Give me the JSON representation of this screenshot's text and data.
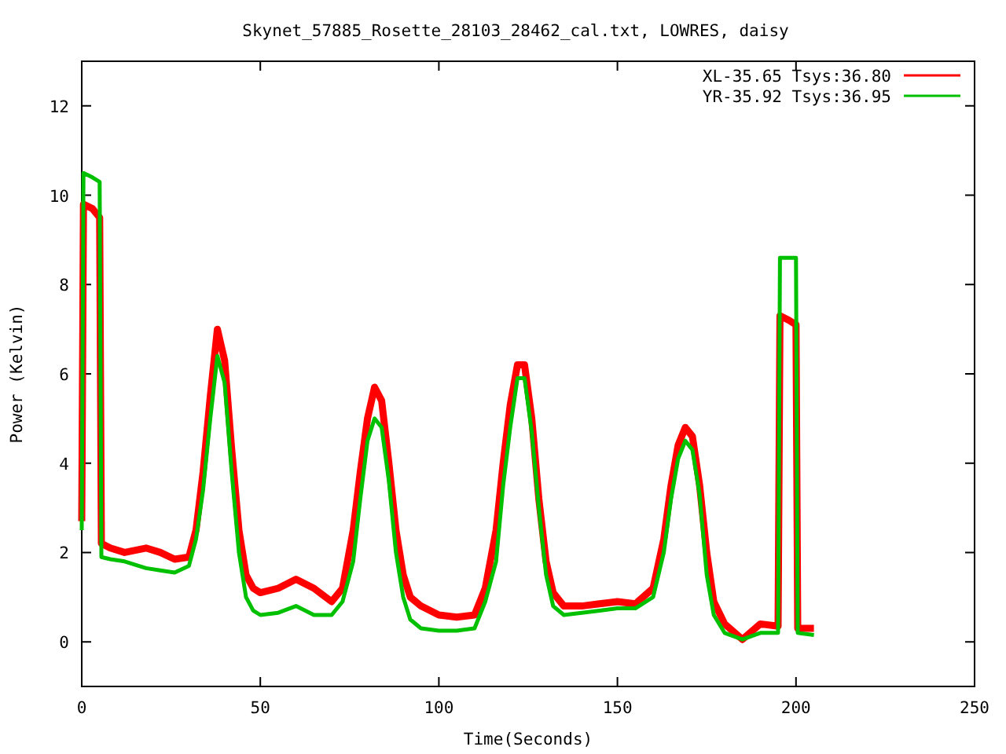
{
  "plot": {
    "chart_data": {
      "type": "line",
      "title": "Skynet_57885_Rosette_28103_28462_cal.txt, LOWRES, daisy",
      "xlabel": "Time(Seconds)",
      "ylabel": "Power (Kelvin)",
      "x": [
        0,
        0.5,
        3,
        5,
        5.5,
        8,
        12,
        18,
        22,
        26,
        30,
        32,
        34,
        36,
        38,
        40,
        42,
        44,
        46,
        48,
        50,
        55,
        60,
        65,
        70,
        73,
        76,
        78,
        80,
        82,
        84,
        86,
        88,
        90,
        92,
        95,
        100,
        105,
        110,
        113,
        116,
        118,
        120,
        122,
        124,
        126,
        128,
        130,
        132,
        135,
        140,
        145,
        150,
        155,
        160,
        163,
        165,
        167,
        169,
        171,
        173,
        175,
        177,
        180,
        185,
        190,
        195,
        195.5,
        198,
        200,
        200.5,
        205
      ],
      "series": [
        {
          "name": "XL-35.65 Tsys:36.80",
          "color": "#ff0000",
          "values": [
            2.7,
            9.8,
            9.7,
            9.5,
            2.2,
            2.1,
            2.0,
            2.1,
            2.0,
            1.85,
            1.9,
            2.5,
            3.8,
            5.5,
            7.0,
            6.3,
            4.3,
            2.5,
            1.5,
            1.2,
            1.1,
            1.2,
            1.4,
            1.2,
            0.9,
            1.2,
            2.5,
            3.8,
            5.0,
            5.7,
            5.4,
            4.0,
            2.5,
            1.5,
            1.0,
            0.8,
            0.6,
            0.55,
            0.6,
            1.2,
            2.5,
            4.0,
            5.3,
            6.2,
            6.2,
            5.0,
            3.2,
            1.8,
            1.1,
            0.8,
            0.8,
            0.85,
            0.9,
            0.85,
            1.2,
            2.3,
            3.5,
            4.4,
            4.8,
            4.6,
            3.5,
            2.0,
            0.9,
            0.4,
            0.05,
            0.4,
            0.35,
            7.3,
            7.2,
            7.1,
            0.3,
            0.3
          ]
        },
        {
          "name": "YR-35.92 Tsys:36.95",
          "color": "#00c000",
          "values": [
            2.5,
            10.5,
            10.4,
            10.3,
            1.9,
            1.85,
            1.8,
            1.65,
            1.6,
            1.55,
            1.7,
            2.3,
            3.4,
            5.0,
            6.4,
            5.8,
            3.8,
            2.0,
            1.0,
            0.7,
            0.6,
            0.65,
            0.8,
            0.6,
            0.6,
            0.9,
            1.8,
            3.2,
            4.5,
            5.0,
            4.8,
            3.6,
            2.0,
            1.0,
            0.5,
            0.3,
            0.25,
            0.25,
            0.3,
            0.9,
            1.8,
            3.5,
            4.8,
            5.9,
            5.9,
            4.7,
            3.0,
            1.5,
            0.8,
            0.6,
            0.65,
            0.7,
            0.75,
            0.75,
            1.0,
            2.0,
            3.2,
            4.1,
            4.5,
            4.3,
            3.3,
            1.5,
            0.6,
            0.2,
            0.05,
            0.2,
            0.2,
            8.6,
            8.6,
            8.6,
            0.2,
            0.15
          ]
        }
      ],
      "xlim": [
        0,
        250
      ],
      "ylim": [
        -1,
        13
      ],
      "xticks": [
        0,
        50,
        100,
        150,
        200,
        250
      ],
      "yticks": [
        0,
        2,
        4,
        6,
        8,
        10,
        12
      ],
      "legend": true
    }
  }
}
